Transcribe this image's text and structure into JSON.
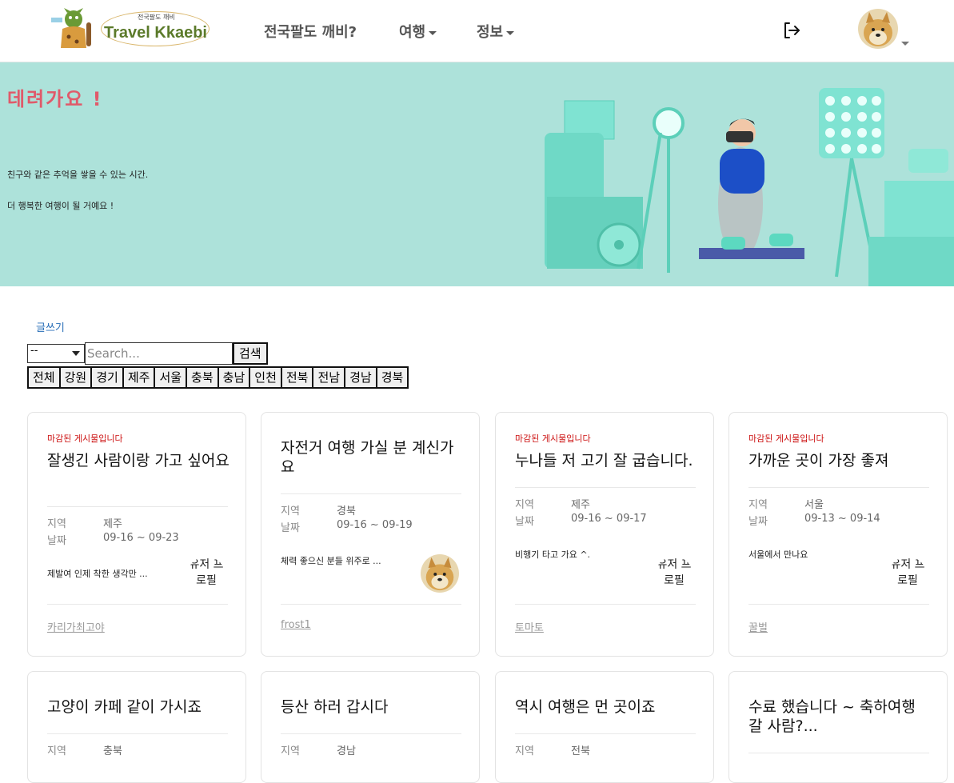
{
  "header": {
    "brand": "Travel Kkaebi",
    "brand_sub": "전국팔도 깨비",
    "nav": [
      {
        "label": "전국팔도 깨비?"
      },
      {
        "label": "여행"
      },
      {
        "label": "정보"
      }
    ]
  },
  "banner": {
    "title": "데려가요 !",
    "line1": "친구와 같은 추억을 쌓을 수 있는 시간.",
    "line2": "더 행복한 여행이 될 거예요 !",
    "bg_color": "#ade2da",
    "title_color": "#e05a6a"
  },
  "controls": {
    "write_label": "글쓰기",
    "select_value": "--",
    "search_placeholder": "Search...",
    "search_button": "검색",
    "regions": [
      "전체",
      "강원",
      "경기",
      "제주",
      "서울",
      "충북",
      "충남",
      "인천",
      "전북",
      "전남",
      "경남",
      "경북"
    ]
  },
  "labels": {
    "region": "지역",
    "date": "날짜",
    "broken_profile": "유저 프로필"
  },
  "cards": [
    {
      "closed": "마감된 게시물입니다",
      "title": "잘생긴 사람이랑 가고 싶어요",
      "region": "제주",
      "date": "09-16 ~ 09-23",
      "desc": "제발여 인제 착한 생각만 ...",
      "author": "카리가최고야"
    },
    {
      "closed": "",
      "title": "자전거 여행 가실 분 계신가요",
      "region": "경북",
      "date": "09-16 ~ 09-19",
      "desc": "체력 좋으신 분들 위주로 ...",
      "author": "frost1"
    },
    {
      "closed": "마감된 게시물입니다",
      "title": "누나들 저 고기 잘 굽습니다.",
      "region": "제주",
      "date": "09-16 ~ 09-17",
      "desc": "비행기 타고 가요 ^.",
      "author": "토마토"
    },
    {
      "closed": "마감된 게시물입니다",
      "title": "가까운 곳이 가장 좋져",
      "region": "서울",
      "date": "09-13 ~ 09-14",
      "desc": "서울에서 만나요",
      "author": "꿀벌"
    },
    {
      "closed": "",
      "title": "고양이 카페 같이 가시죠",
      "region": "충북"
    },
    {
      "closed": "",
      "title": "등산 하러 갑시다",
      "region": "경남"
    },
    {
      "closed": "",
      "title": "역시 여행은 먼 곳이죠",
      "region": "전북"
    },
    {
      "closed": "",
      "title": "수료 했습니다 ~ 축하여행 갈 사람?..."
    }
  ]
}
